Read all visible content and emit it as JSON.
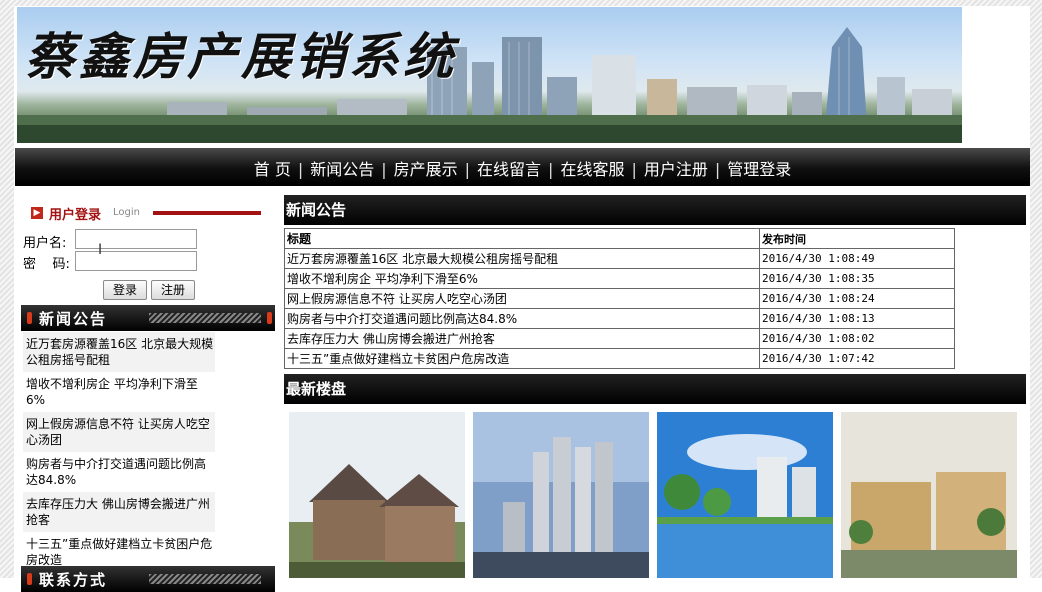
{
  "banner": {
    "title": "蔡鑫房产展销系统"
  },
  "nav": [
    {
      "label": "首  页"
    },
    {
      "label": "新闻公告"
    },
    {
      "label": "房产展示"
    },
    {
      "label": "在线留言"
    },
    {
      "label": "在线客服"
    },
    {
      "label": "用户注册"
    },
    {
      "label": "管理登录"
    }
  ],
  "login": {
    "title": "用户登录",
    "subtitle": "Login",
    "username_label": "用户名:",
    "password_label": "密    码:",
    "username_value": "",
    "password_value": "",
    "login_button": "登录",
    "register_button": "注册"
  },
  "sidebar": {
    "news_title": "新闻公告",
    "news_items": [
      {
        "text": "近万套房源覆盖16区 北京最大规模公租房摇号配租"
      },
      {
        "text": "增收不增利房企 平均净利下滑至6%"
      },
      {
        "text": "网上假房源信息不符 让买房人吃空心汤团"
      },
      {
        "text": "购房者与中介打交道遇问题比例高达84.8%"
      },
      {
        "text": "去库存压力大 佛山房博会搬进广州抢客"
      },
      {
        "text": "十三五”重点做好建档立卡贫困户危房改造"
      }
    ],
    "next_title": "联系方式"
  },
  "news_section": {
    "title": "新闻公告",
    "col_title": "标题",
    "col_time": "发布时间",
    "rows": [
      {
        "title": "近万套房源覆盖16区 北京最大规模公租房摇号配租",
        "time": "2016/4/30 1:08:49"
      },
      {
        "title": "增收不增利房企 平均净利下滑至6%",
        "time": "2016/4/30 1:08:35"
      },
      {
        "title": "网上假房源信息不符 让买房人吃空心汤团",
        "time": "2016/4/30 1:08:24"
      },
      {
        "title": "购房者与中介打交道遇问题比例高达84.8%",
        "time": "2016/4/30 1:08:13"
      },
      {
        "title": "去库存压力大 佛山房博会搬进广州抢客",
        "time": "2016/4/30 1:08:02"
      },
      {
        "title": "十三五”重点做好建档立卡贫困户危房改造",
        "time": "2016/4/30 1:07:42"
      }
    ]
  },
  "listings_section": {
    "title": "最新楼盘"
  }
}
